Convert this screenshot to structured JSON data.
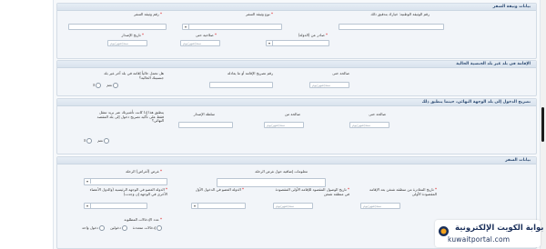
{
  "travel_doc": {
    "title": "بيانات وثيقة السفر",
    "doc_number_label": "رقم الوثيقة الوطنية: خيارك بتدقيق ذلك",
    "doc_type_label": "نوع وثيقة السفر",
    "doc_number2_label": "رقم وثيقة السفر",
    "issue_place_label": "مكان الإصدار",
    "issue_country_label": "صادر عن (الدولة)",
    "expiry_label": "صلاحية حتى",
    "issue_date_label": "تاريخ الإصدار",
    "date_placeholder": "سنة/شهر/يوم"
  },
  "residence": {
    "title": "الإقامة في بلد غير بلد الجنسية الحالية",
    "question": "هل تحمل حالياً إقامة في بلد آخر غير بلد جنسيتك الحالية؟",
    "permit_label": "رقم تصريح الإقامة أو ما يعادله",
    "validity_label": "صالحة حتى",
    "date_placeholder": "سنة/شهر/يوم",
    "yes": "نعم",
    "no": "لا"
  },
  "entry_permit": {
    "title": "تصريح الدخول إلى بلد الوجهة النهائي، حيثما ينطبق ذلك",
    "question": "ينطبق هذا إذا كانت تأشيرتك عبر بريد تنتقل فقط على تأكيد تصريح دخول إلى بلد المقصد النهائي؟",
    "issued_by_label": "سلطة الإصدار",
    "valid_from_label": "صالحة من",
    "valid_to_label": "صالحة حتى",
    "date_placeholder": "سنة/شهر/يوم",
    "yes": "نعم",
    "no": "لا"
  },
  "travel_info": {
    "title": "بيانات السفر",
    "purpose_label": "غرض (أغراض) الرحلة",
    "extra_info_label": "معلومات إضافية حول غرض الرحلة",
    "main_dest_label": "الدولة العضو في الوجهة الرئيسية (والدول الأعضاء الأخرى في الوجهة إن وجدت)",
    "first_entry_label": "الدولة العضو في الدخول الأول",
    "arrival_date_label": "تاريخ الوصول المقصود للإقامة الأولى المقصودة في منطقة شنغن",
    "departure_date_label": "تاريخ المغادرة من منطقة شنغن بعد الإقامة المقصودة الأولى",
    "entries_label": "عدد الإدخالات المطلوبة",
    "entries_options": [
      "دخول واحد",
      "دخولين",
      "إدخالات متعددة"
    ],
    "date_placeholder": "سنة/شهر/يوم"
  },
  "logo": {
    "arabic": "بوابة الكويت الإلكترونية",
    "english": "kuwaitportal.com"
  },
  "colors": {
    "header_text": "#2c4a72",
    "required": "#dd0000",
    "logo_text": "#1a2f5a"
  }
}
